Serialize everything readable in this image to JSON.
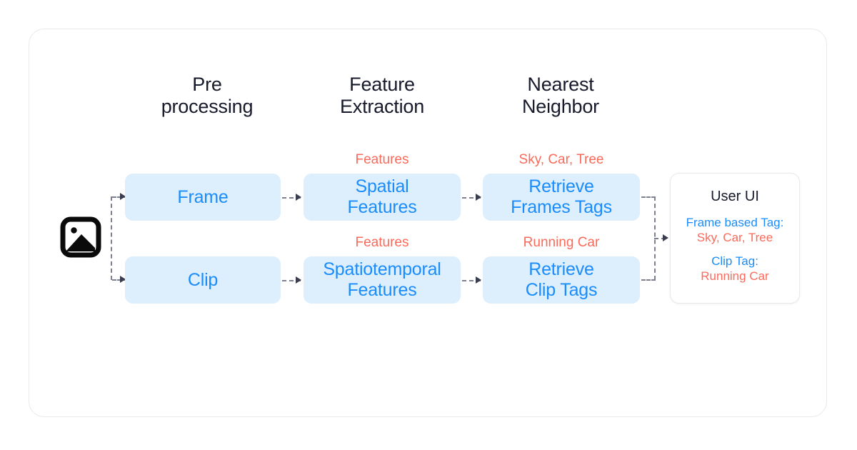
{
  "diagram": {
    "columns": [
      {
        "label": "Pre\nprocessing"
      },
      {
        "label": "Feature\nExtraction"
      },
      {
        "label": "Nearest\nNeighbor"
      }
    ],
    "source": {
      "icon": "image-icon"
    },
    "rows": [
      {
        "name": "frame-pipeline",
        "stage1": "Frame",
        "stage2": "Spatial\nFeatures",
        "stage3": "Retrieve\nFrames Tags",
        "label_after_stage1": "Features",
        "label_after_stage2": "Sky, Car, Tree"
      },
      {
        "name": "clip-pipeline",
        "stage1": "Clip",
        "stage2": "Spatiotemporal\nFeatures",
        "stage3": "Retrieve\nClip Tags",
        "label_after_stage1": "Features",
        "label_after_stage2": "Running Car"
      }
    ],
    "user_ui": {
      "title": "User UI",
      "entries": [
        {
          "key": "Frame based Tag:",
          "value": "Sky, Car, Tree"
        },
        {
          "key": "Clip Tag:",
          "value": "Running Car"
        }
      ]
    },
    "colors": {
      "box_fill": "#ddeefc",
      "box_text": "#1a8cfb",
      "annotation": "#fa6a5a",
      "heading": "#171a2b",
      "connector": "#7c8091",
      "card_border": "#e9e9eb"
    }
  }
}
